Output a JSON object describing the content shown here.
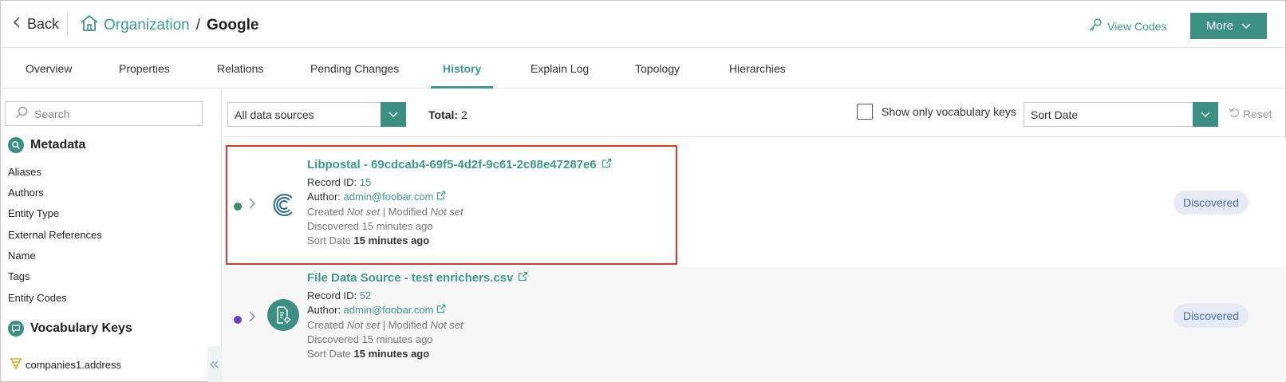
{
  "header": {
    "back_label": "Back",
    "breadcrumb_org": "Organization",
    "breadcrumb_sep": "/",
    "entity_name": "Google",
    "view_codes_label": "View Codes",
    "more_label": "More"
  },
  "tabs": [
    {
      "label": "Overview"
    },
    {
      "label": "Properties"
    },
    {
      "label": "Relations"
    },
    {
      "label": "Pending Changes"
    },
    {
      "label": "History",
      "active": true
    },
    {
      "label": "Explain Log"
    },
    {
      "label": "Topology"
    },
    {
      "label": "Hierarchies"
    }
  ],
  "sidebar": {
    "search_placeholder": "Search",
    "metadata_title": "Metadata",
    "metadata_items": [
      "Aliases",
      "Authors",
      "Entity Type",
      "External References",
      "Name",
      "Tags",
      "Entity Codes"
    ],
    "vocab_title": "Vocabulary Keys",
    "vocab_items": [
      "companies1.address"
    ]
  },
  "toolbar": {
    "data_source_value": "All data sources",
    "total_label": "Total:",
    "total_value": "2",
    "vocab_only_label": "Show only vocabulary keys",
    "sort_value": "Sort Date",
    "reset_label": "Reset"
  },
  "records": [
    {
      "title": "Libpostal - 69cdcab4-69f5-4d2f-9c61-2c88e47287e6",
      "record_id_label": "Record ID:",
      "record_id": "15",
      "author_label": "Author:",
      "author": "admin@foobar.com",
      "created_label": "Created",
      "created_value": "Not set",
      "modified_label": "| Modified",
      "modified_value": "Not set",
      "discovered": "Discovered 15 minutes ago",
      "sort_date_label": "Sort Date",
      "sort_date_value": "15 minutes ago",
      "status": "Discovered",
      "dot_color": "#3f8f6a",
      "icon": "libpostal-logo-icon"
    },
    {
      "title": "File Data Source - test enrichers.csv",
      "record_id_label": "Record ID:",
      "record_id": "52",
      "author_label": "Author:",
      "author": "admin@foobar.com",
      "created_label": "Created",
      "created_value": "Not set",
      "modified_label": "| Modified",
      "modified_value": "Not set",
      "discovered": "Discovered 15 minutes ago",
      "sort_date_label": "Sort Date",
      "sort_date_value": "15 minutes ago",
      "status": "Discovered",
      "dot_color": "#6a3fc4",
      "icon": "file-settings-icon"
    }
  ],
  "colors": {
    "accent": "#3c9a8f",
    "button": "#3b8f83",
    "highlight": "#e0352b",
    "badge_bg": "#e5eaf5"
  }
}
